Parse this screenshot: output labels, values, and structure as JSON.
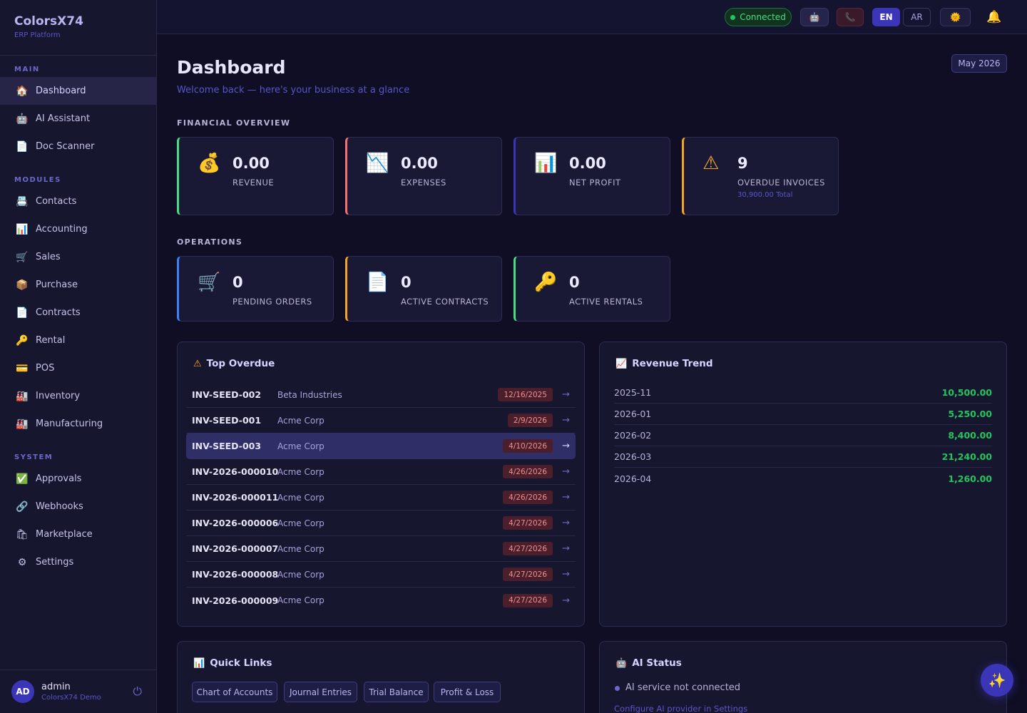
{
  "brand": {
    "title": "ColorsX74",
    "subtitle": "ERP Platform"
  },
  "nav": {
    "main_label": "MAIN",
    "main_items": [
      {
        "label": "Dashboard",
        "icon": "🏠"
      },
      {
        "label": "AI Assistant",
        "icon": "🤖"
      },
      {
        "label": "Doc Scanner",
        "icon": "📄"
      }
    ],
    "modules_label": "MODULES",
    "module_items": [
      {
        "label": "Contacts",
        "icon": "📇"
      },
      {
        "label": "Accounting",
        "icon": "📊"
      },
      {
        "label": "Sales",
        "icon": "🛒"
      },
      {
        "label": "Purchase",
        "icon": "📦"
      },
      {
        "label": "Contracts",
        "icon": "📄"
      },
      {
        "label": "Rental",
        "icon": "🔑"
      },
      {
        "label": "POS",
        "icon": "💳"
      },
      {
        "label": "Inventory",
        "icon": "🏭"
      },
      {
        "label": "Manufacturing",
        "icon": "🏭"
      }
    ],
    "system_label": "SYSTEM",
    "system_items": [
      {
        "label": "Approvals",
        "icon": "✅"
      },
      {
        "label": "Webhooks",
        "icon": "🔗"
      },
      {
        "label": "Marketplace",
        "icon": "🛍"
      },
      {
        "label": "Settings",
        "icon": "⚙"
      }
    ]
  },
  "user": {
    "initials": "AD",
    "name": "admin",
    "org": "ColorsX74 Demo"
  },
  "topbar": {
    "connection": "Connected",
    "lang_en": "EN",
    "lang_ar": "AR"
  },
  "page": {
    "title": "Dashboard",
    "subtitle": "Welcome back — here's your business at a glance",
    "month": "May 2026"
  },
  "financial": {
    "label": "FINANCIAL OVERVIEW",
    "cards": [
      {
        "value": "0.00",
        "label": "REVENUE",
        "icon": "💰",
        "color": "#4ade80"
      },
      {
        "value": "0.00",
        "label": "EXPENSES",
        "icon": "📉",
        "color": "#f87171"
      },
      {
        "value": "0.00",
        "label": "NET PROFIT",
        "icon": "📊",
        "color": "#3b36b8"
      },
      {
        "value": "9",
        "label": "OVERDUE INVOICES",
        "icon": "⚠",
        "color": "#f5a524",
        "sub": "30,900.00 Total"
      }
    ]
  },
  "operations": {
    "label": "OPERATIONS",
    "cards": [
      {
        "value": "0",
        "label": "PENDING ORDERS",
        "icon": "🛒",
        "color": "#3b82f6"
      },
      {
        "value": "0",
        "label": "ACTIVE CONTRACTS",
        "icon": "📄",
        "color": "#f5a524"
      },
      {
        "value": "0",
        "label": "ACTIVE RENTALS",
        "icon": "🔑",
        "color": "#4ade80"
      }
    ]
  },
  "top_overdue": {
    "title": "Top Overdue",
    "rows": [
      {
        "invoice": "INV-SEED-002",
        "customer": "Beta Industries",
        "date": "12/16/2025"
      },
      {
        "invoice": "INV-SEED-001",
        "customer": "Acme Corp",
        "date": "2/9/2026"
      },
      {
        "invoice": "INV-SEED-003",
        "customer": "Acme Corp",
        "date": "4/10/2026"
      },
      {
        "invoice": "INV-2026-000010",
        "customer": "Acme Corp",
        "date": "4/26/2026"
      },
      {
        "invoice": "INV-2026-000011",
        "customer": "Acme Corp",
        "date": "4/26/2026"
      },
      {
        "invoice": "INV-2026-000006",
        "customer": "Acme Corp",
        "date": "4/27/2026"
      },
      {
        "invoice": "INV-2026-000007",
        "customer": "Acme Corp",
        "date": "4/27/2026"
      },
      {
        "invoice": "INV-2026-000008",
        "customer": "Acme Corp",
        "date": "4/27/2026"
      },
      {
        "invoice": "INV-2026-000009",
        "customer": "Acme Corp",
        "date": "4/27/2026"
      }
    ]
  },
  "revenue_trend": {
    "title": "Revenue Trend",
    "rows": [
      {
        "month": "2025-11",
        "value": "10,500.00"
      },
      {
        "month": "2026-01",
        "value": "5,250.00"
      },
      {
        "month": "2026-02",
        "value": "8,400.00"
      },
      {
        "month": "2026-03",
        "value": "21,240.00"
      },
      {
        "month": "2026-04",
        "value": "1,260.00"
      }
    ]
  },
  "quick_links": {
    "title": "Quick Links",
    "items": [
      "Chart of Accounts",
      "Journal Entries",
      "Trial Balance",
      "Profit & Loss"
    ]
  },
  "ai_status": {
    "title": "AI Status",
    "status": "AI service not connected",
    "link": "Configure AI provider in Settings"
  }
}
